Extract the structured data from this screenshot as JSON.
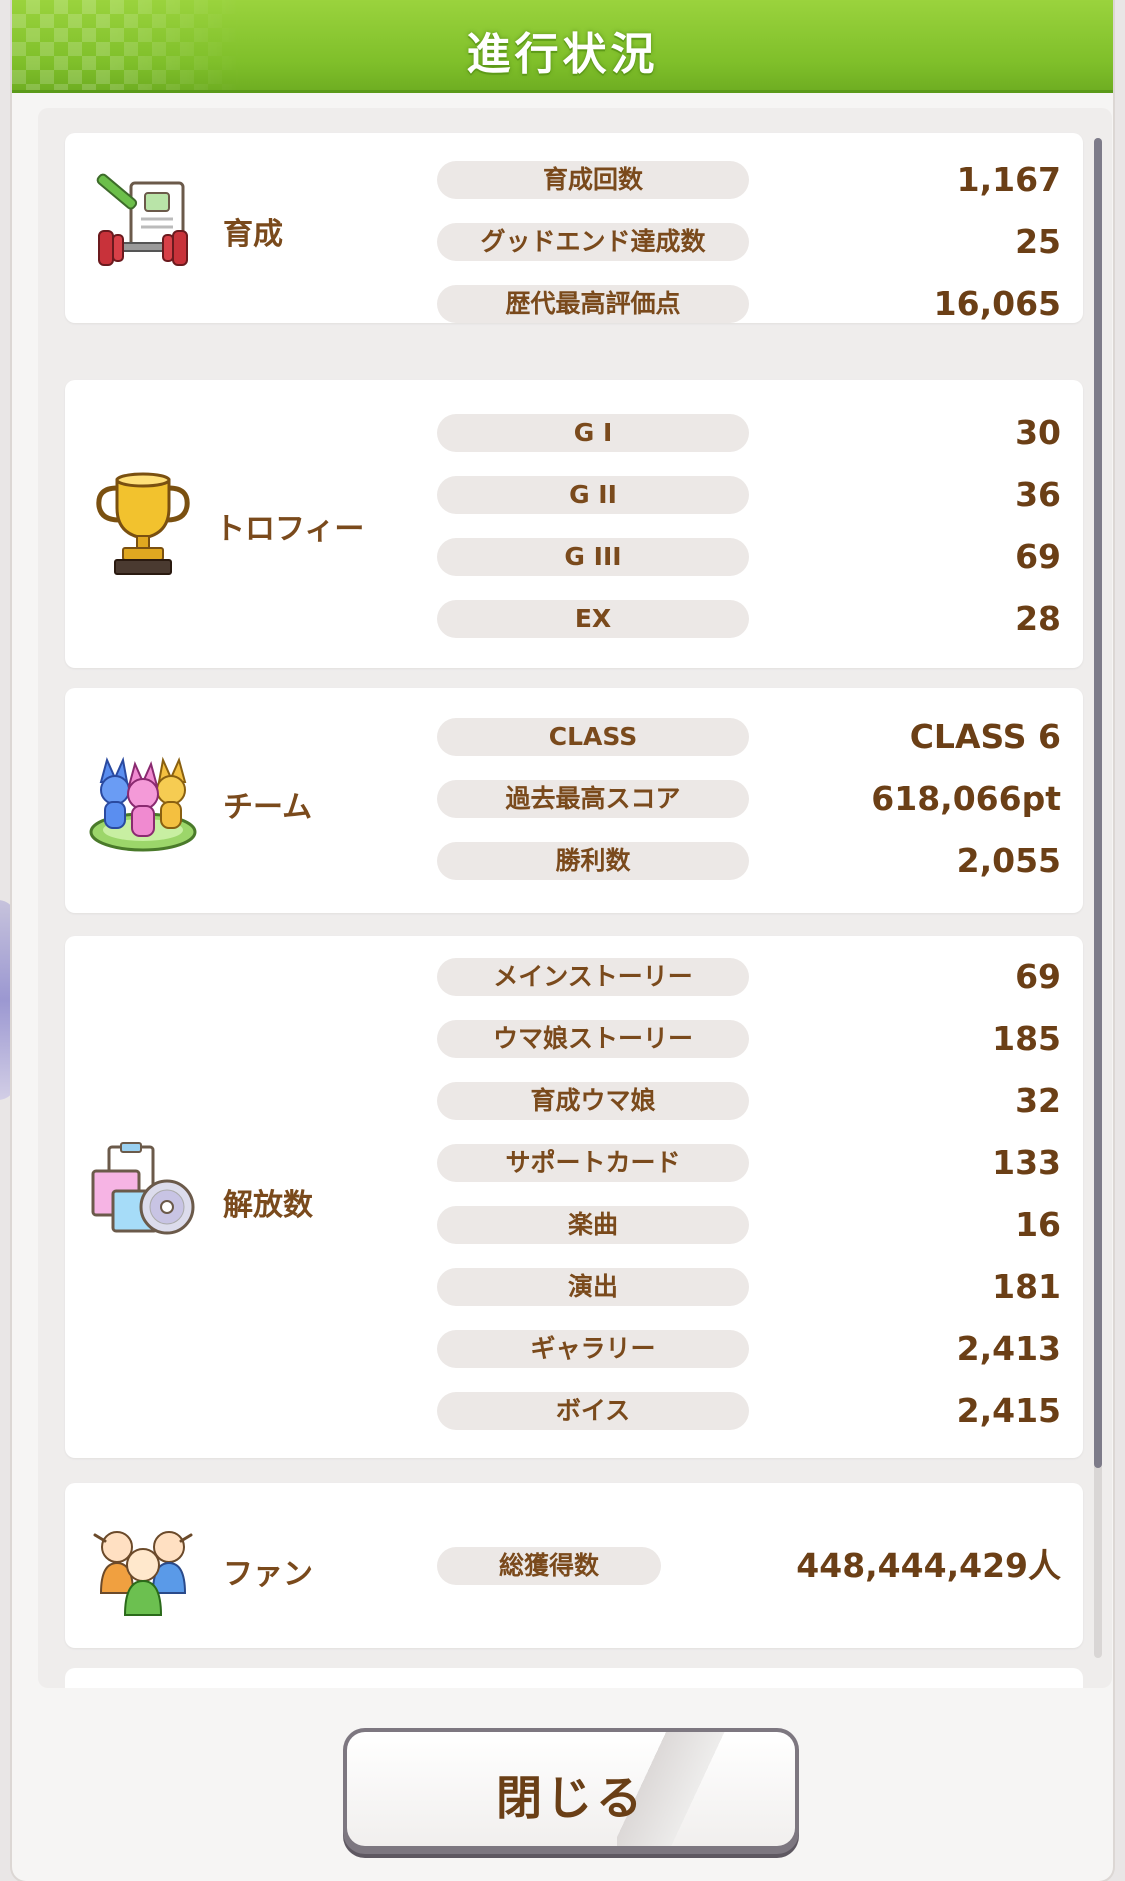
{
  "title": "進行状況",
  "sections": [
    {
      "id": "ikusei",
      "label": "育成",
      "icon": "training-icon",
      "rows": [
        {
          "label": "育成回数",
          "value": "1,167"
        },
        {
          "label": "グッドエンド達成数",
          "value": "25"
        },
        {
          "label": "歴代最高評価点",
          "value": "16,065"
        }
      ]
    },
    {
      "id": "trophy",
      "label": "トロフィー",
      "icon": "trophy-icon",
      "rows": [
        {
          "label": "G I",
          "value": "30"
        },
        {
          "label": "G II",
          "value": "36"
        },
        {
          "label": "G III",
          "value": "69"
        },
        {
          "label": "EX",
          "value": "28"
        }
      ]
    },
    {
      "id": "team",
      "label": "チーム",
      "icon": "team-icon",
      "rows": [
        {
          "label": "CLASS",
          "value": "CLASS 6"
        },
        {
          "label": "過去最高スコア",
          "value": "618,066pt"
        },
        {
          "label": "勝利数",
          "value": "2,055"
        }
      ]
    },
    {
      "id": "unlock",
      "label": "解放数",
      "icon": "unlock-media-icon",
      "rows": [
        {
          "label": "メインストーリー",
          "value": "69"
        },
        {
          "label": "ウマ娘ストーリー",
          "value": "185"
        },
        {
          "label": "育成ウマ娘",
          "value": "32"
        },
        {
          "label": "サポートカード",
          "value": "133"
        },
        {
          "label": "楽曲",
          "value": "16"
        },
        {
          "label": "演出",
          "value": "181"
        },
        {
          "label": "ギャラリー",
          "value": "2,413"
        },
        {
          "label": "ボイス",
          "value": "2,415"
        }
      ]
    },
    {
      "id": "fan",
      "label": "ファン",
      "icon": "fans-icon",
      "rows": [
        {
          "label": "総獲得数",
          "value": "448,444,429人"
        }
      ]
    }
  ],
  "close_button": {
    "label": "閉じる"
  },
  "colors": {
    "title_green": "#8cc83a",
    "label_brown": "#7a4a1c",
    "pill_bg": "#ece8e6"
  }
}
